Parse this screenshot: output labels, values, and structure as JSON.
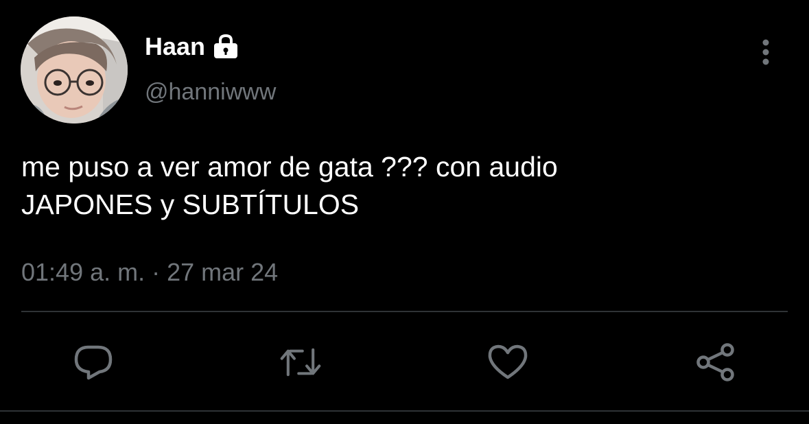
{
  "user": {
    "display_name": "Haan",
    "handle": "@hanniwww",
    "protected_icon": "lock-icon",
    "avatar_icon": "avatar-photo"
  },
  "tweet": {
    "text": "me puso a ver amor de gata ??? con audio\nJAPONES y SUBTÍTULOS",
    "timestamp": "01:49 a. m. · 27 mar 24"
  },
  "actions": [
    {
      "icon": "reply-icon"
    },
    {
      "icon": "retweet-icon"
    },
    {
      "icon": "like-icon"
    },
    {
      "icon": "share-icon"
    }
  ],
  "menu": {
    "icon": "more-vertical-icon"
  },
  "colors": {
    "background": "#000000",
    "primary_text": "#ffffff",
    "secondary_text": "#71767b",
    "divider": "#2f3336"
  }
}
